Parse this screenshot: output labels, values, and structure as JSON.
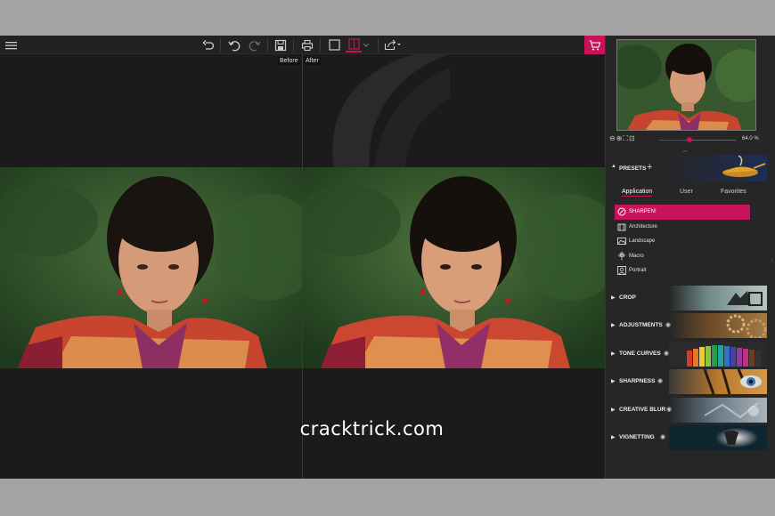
{
  "toolbar": {
    "buttons": [
      "menu-icon",
      "undo-all-icon",
      "undo-icon",
      "redo-icon",
      "save-icon",
      "print-icon",
      "single-view-icon",
      "split-view-icon",
      "share-icon"
    ],
    "cart_icon": "cart-icon"
  },
  "compare": {
    "before_label": "Before",
    "after_label": "After"
  },
  "watermark": "cracktrick.com",
  "navigator": {
    "zoom_value": "64.0 %",
    "zoom_fraction": 0.4
  },
  "presets": {
    "title": "PRESETS",
    "tabs": [
      "Application",
      "User",
      "Favorites"
    ],
    "items": [
      "SHARPEN!",
      "Architecture",
      "Landscape",
      "Macro",
      "Portrait"
    ]
  },
  "sections": [
    "CROP",
    "ADJUSTMENTS",
    "TONE CURVES",
    "SHARPNESS",
    "CREATIVE BLUR",
    "VIGNETTING"
  ],
  "colors": {
    "accent": "#c8125a",
    "bg": "#1b1b1b",
    "panel": "#262626"
  }
}
